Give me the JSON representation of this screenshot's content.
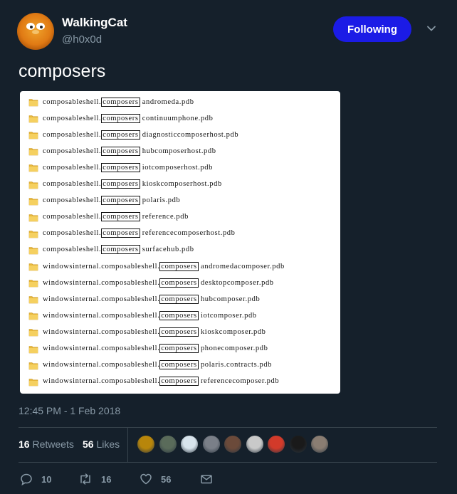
{
  "user": {
    "name": "WalkingCat",
    "handle": "@h0x0d",
    "follow_label": "Following"
  },
  "tweet": {
    "text": "composers",
    "timestamp": "12:45 PM - 1 Feb 2018"
  },
  "media": {
    "files": [
      {
        "prefix": "composableshell.",
        "highlight": "composers",
        "suffix": " andromeda.pdb"
      },
      {
        "prefix": "composableshell.",
        "highlight": "composers",
        "suffix": " continuumphone.pdb"
      },
      {
        "prefix": "composableshell.",
        "highlight": "composers",
        "suffix": " diagnosticcomposerhost.pdb"
      },
      {
        "prefix": "composableshell.",
        "highlight": "composers",
        "suffix": " hubcomposerhost.pdb"
      },
      {
        "prefix": "composableshell.",
        "highlight": "composers",
        "suffix": " iotcomposerhost.pdb"
      },
      {
        "prefix": "composableshell.",
        "highlight": "composers",
        "suffix": " kioskcomposerhost.pdb"
      },
      {
        "prefix": "composableshell.",
        "highlight": "composers",
        "suffix": " polaris.pdb"
      },
      {
        "prefix": "composableshell.",
        "highlight": "composers",
        "suffix": " reference.pdb"
      },
      {
        "prefix": "composableshell.",
        "highlight": "composers",
        "suffix": " referencecomposerhost.pdb"
      },
      {
        "prefix": "composableshell.",
        "highlight": "composers",
        "suffix": " surfacehub.pdb"
      },
      {
        "prefix": "windowsinternal.composableshell.",
        "highlight": "composers",
        "suffix": " andromedacomposer.pdb"
      },
      {
        "prefix": "windowsinternal.composableshell.",
        "highlight": "composers",
        "suffix": " desktopcomposer.pdb"
      },
      {
        "prefix": "windowsinternal.composableshell.",
        "highlight": "composers",
        "suffix": " hubcomposer.pdb"
      },
      {
        "prefix": "windowsinternal.composableshell.",
        "highlight": "composers",
        "suffix": " iotcomposer.pdb"
      },
      {
        "prefix": "windowsinternal.composableshell.",
        "highlight": "composers",
        "suffix": " kioskcomposer.pdb"
      },
      {
        "prefix": "windowsinternal.composableshell.",
        "highlight": "composers",
        "suffix": " phonecomposer.pdb"
      },
      {
        "prefix": "windowsinternal.composableshell.",
        "highlight": "composers",
        "suffix": " polaris.contracts.pdb"
      },
      {
        "prefix": "windowsinternal.composableshell.",
        "highlight": "composers",
        "suffix": " referencecomposer.pdb"
      }
    ]
  },
  "stats": {
    "retweets_count": "16",
    "retweets_label": "Retweets",
    "likes_count": "56",
    "likes_label": "Likes"
  },
  "likers": [
    {
      "icon": "avatar-1",
      "color": "#b8860b"
    },
    {
      "icon": "avatar-2",
      "color": "#5a6b5a"
    },
    {
      "icon": "avatar-3",
      "color": "#d8e4ec"
    },
    {
      "icon": "avatar-4",
      "color": "#7a7f88"
    },
    {
      "icon": "avatar-5",
      "color": "#6b4a3a"
    },
    {
      "icon": "avatar-6",
      "color": "#c9c9c9"
    },
    {
      "icon": "avatar-7",
      "color": "#d23a2a"
    },
    {
      "icon": "avatar-8",
      "color": "#1a1a1a"
    },
    {
      "icon": "avatar-9",
      "color": "#8a7d72"
    }
  ],
  "actions": {
    "reply_count": "10",
    "retweet_count": "16",
    "like_count": "56"
  },
  "colors": {
    "background": "#15202b",
    "accent": "#1b1be6",
    "muted": "#8899a6",
    "divider": "#38444d"
  }
}
